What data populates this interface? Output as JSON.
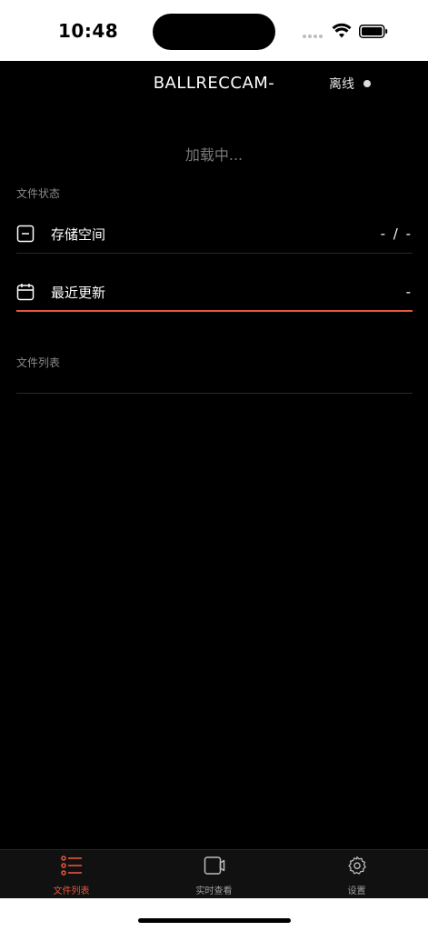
{
  "status_bar": {
    "time": "10:48"
  },
  "header": {
    "device_title": "BALLRECCAM-",
    "connection_status": "离线"
  },
  "loading_text": "加载中...",
  "file_status": {
    "section_title": "文件状态",
    "storage": {
      "label": "存储空间",
      "value": "- / -"
    },
    "last_update": {
      "label": "最近更新",
      "value": "-"
    }
  },
  "file_list": {
    "section_title": "文件列表"
  },
  "tab_bar": {
    "tabs": [
      {
        "label": "文件列表",
        "icon": "list-icon",
        "active": true
      },
      {
        "label": "实时查看",
        "icon": "camera-icon",
        "active": false
      },
      {
        "label": "设置",
        "icon": "gear-icon",
        "active": false
      }
    ]
  },
  "colors": {
    "accent": "#e4573b",
    "background": "#000000",
    "tab_bar_bg": "#111111"
  }
}
